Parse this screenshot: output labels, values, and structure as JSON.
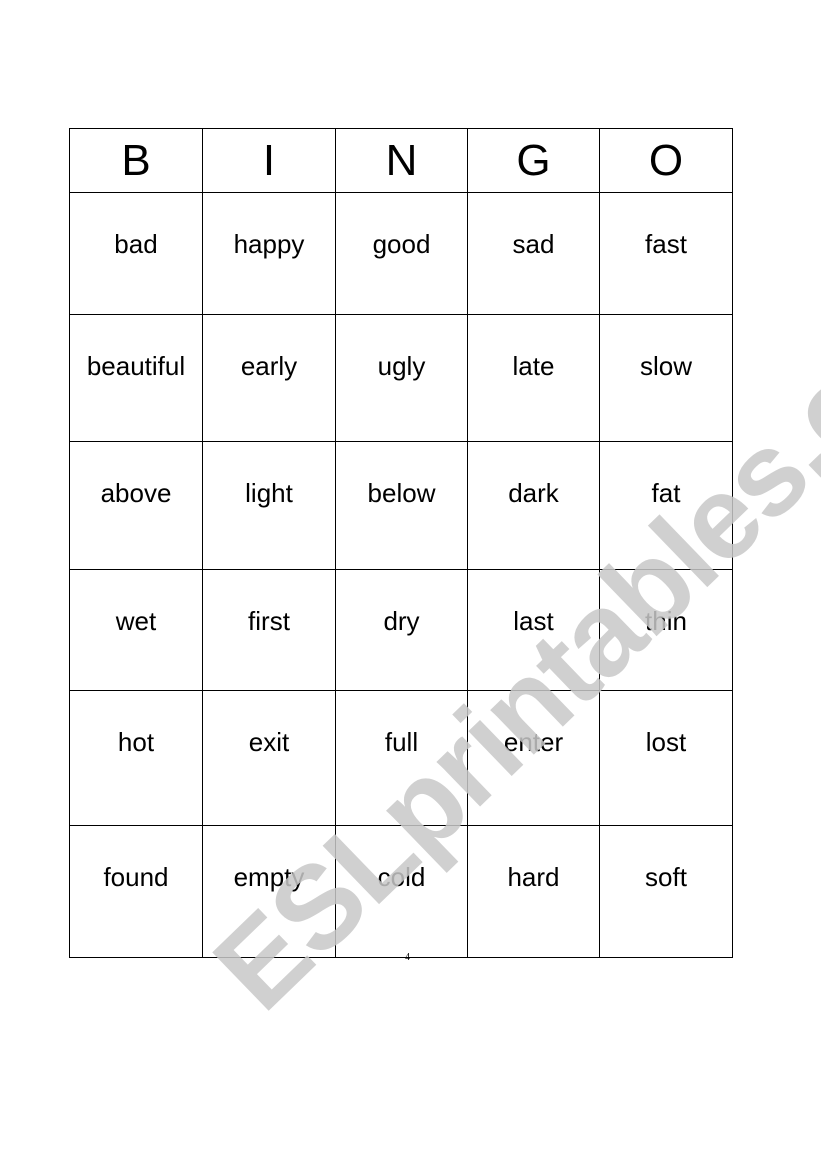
{
  "header": [
    "B",
    "I",
    "N",
    "G",
    "O"
  ],
  "rows": [
    [
      "bad",
      "happy",
      "good",
      "sad",
      "fast"
    ],
    [
      "beautiful",
      "early",
      "ugly",
      "late",
      "slow"
    ],
    [
      "above",
      "light",
      "below",
      "dark",
      "fat"
    ],
    [
      "wet",
      "first",
      "dry",
      "last",
      "thin"
    ],
    [
      "hot",
      "exit",
      "full",
      "enter",
      "lost"
    ],
    [
      "found",
      "empty",
      "cold",
      "hard",
      "soft"
    ]
  ],
  "page_number": "4",
  "watermark": "ESLprintables.com"
}
